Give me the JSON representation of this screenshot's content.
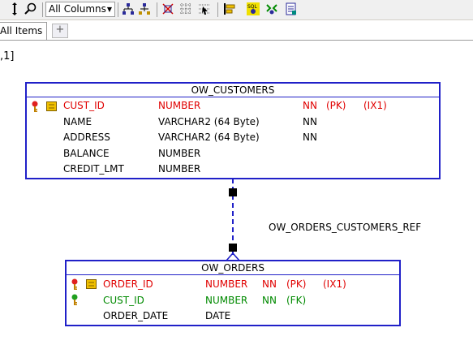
{
  "toolbar": {
    "columns_dropdown": "All Columns"
  },
  "tabs": {
    "all_items": "All Items",
    "add": "+"
  },
  "zoom_label": ",1]",
  "entities": {
    "customers": {
      "name": "OW_CUSTOMERS",
      "columns": [
        {
          "name": "CUST_ID",
          "type": "NUMBER",
          "nn": "NN",
          "pk": "(PK)",
          "ix": "(IX1)"
        },
        {
          "name": "NAME",
          "type": "VARCHAR2 (64 Byte)",
          "nn": "NN"
        },
        {
          "name": "ADDRESS",
          "type": "VARCHAR2 (64 Byte)",
          "nn": "NN"
        },
        {
          "name": "BALANCE",
          "type": "NUMBER"
        },
        {
          "name": "CREDIT_LMT",
          "type": "NUMBER"
        }
      ]
    },
    "orders": {
      "name": "OW_ORDERS",
      "columns": [
        {
          "name": "ORDER_ID",
          "type": "NUMBER",
          "nn": "NN",
          "pk": "(PK)",
          "ix": "(IX1)"
        },
        {
          "name": "CUST_ID",
          "type": "NUMBER",
          "nn": "NN",
          "fk": "(FK)"
        },
        {
          "name": "ORDER_DATE",
          "type": "DATE"
        }
      ]
    }
  },
  "relationship": {
    "name": "OW_ORDERS_CUSTOMERS_REF"
  },
  "colors": {
    "entity_border": "#2020c8",
    "pk_text": "#e00000",
    "fk_text": "#008a00"
  }
}
